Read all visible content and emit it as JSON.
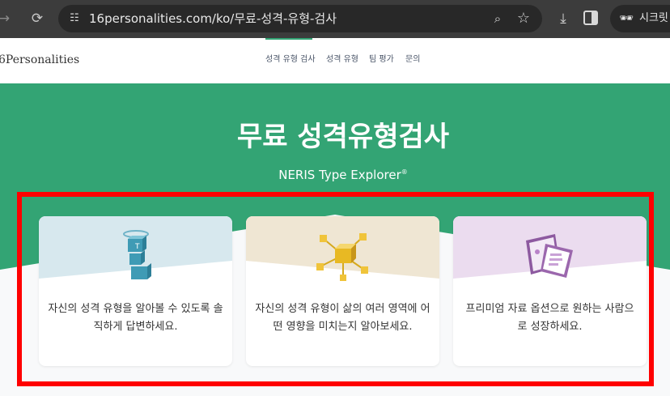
{
  "browser": {
    "url": "16personalities.com/ko/무료-성격-유형-검사",
    "incognito_label": "시크릿",
    "icons": [
      "back-icon",
      "reload-icon",
      "site-settings-icon",
      "zoom-icon",
      "bookmark-star-icon",
      "download-icon",
      "side-panel-icon",
      "incognito-icon"
    ]
  },
  "site": {
    "logo": "6Personalities",
    "nav": [
      {
        "label": "성격 유형 검사"
      },
      {
        "label": "성격 유형"
      },
      {
        "label": "팀 평가"
      },
      {
        "label": "문의"
      }
    ],
    "accent_color": "#33a474"
  },
  "hero": {
    "title": "무료 성격유형검사",
    "subtitle": "NERIS Type Explorer",
    "subtitle_mark": "®"
  },
  "cards": [
    {
      "text": "자신의 성격 유형을 알아볼 수 있도록 솔직하게 답변하세요.",
      "bg_color": "#d7e8ee",
      "icon": "cube-figure-icon"
    },
    {
      "text": "자신의 성격 유형이 삶의 여러 영역에 어떤 영향을 미치는지 알아보세요.",
      "bg_color": "#efe6d3",
      "icon": "cube-network-icon"
    },
    {
      "text": "프리미엄 자료 옵션으로 원하는 사람으로 성장하세요.",
      "bg_color": "#ebdcef",
      "icon": "documents-icon"
    }
  ],
  "highlight_color": "#ff0000"
}
